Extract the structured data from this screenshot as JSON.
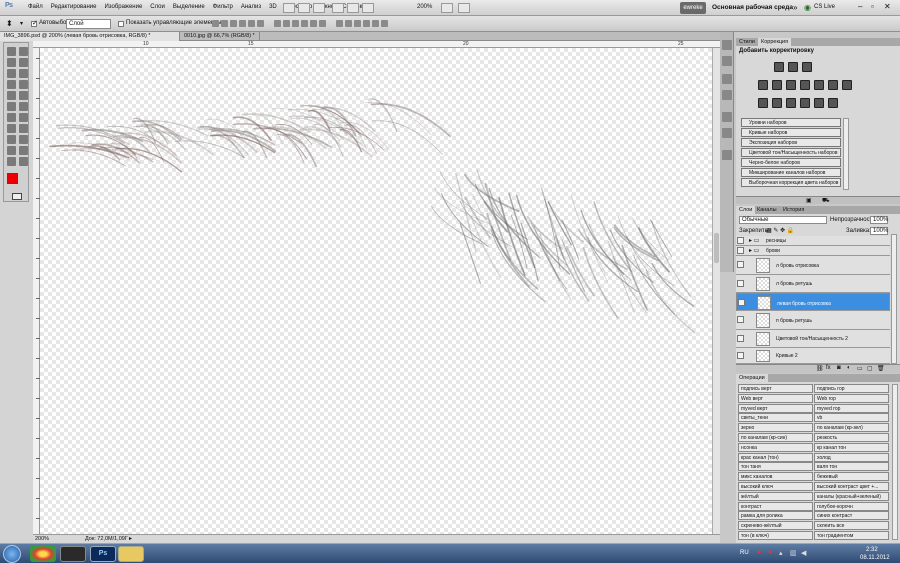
{
  "app": {
    "logo": "Ps",
    "workspace_button": "ewreke",
    "workspace_label": "Основная рабочая среда",
    "cslive": "CS Live"
  },
  "menu": [
    "Файл",
    "Редактирование",
    "Изображение",
    "Слои",
    "Выделение",
    "Фильтр",
    "Анализ",
    "3D",
    "Просмотр",
    "Окно",
    "Справка"
  ],
  "zoom_menu": "200%",
  "options": {
    "autoselect_label": "Автовыбор:",
    "autoselect_value": "Слой",
    "transform_label": "Показать управляющие элементы"
  },
  "doc_tabs": [
    "IMG_3896.psd @ 200% (левая бровь отрисовка, RGB/8) *",
    "0010.jpg @ 66,7% (RGB/8) *"
  ],
  "ruler_marks": [
    "10",
    "15",
    "20",
    "25"
  ],
  "status": {
    "zoom": "200%",
    "doc": "Док: 72,0M/1,09Г"
  },
  "adjustments": {
    "tabs": [
      "Стили",
      "Коррекция"
    ],
    "title": "Добавить корректировку",
    "presets": [
      "Уровни наборов",
      "Кривые наборов",
      "Экспозиция наборов",
      "Цветовой тон/Насыщенность наборов",
      "Черно-белое наборов",
      "Микширование каналов наборов",
      "Выборочная коррекция цвета наборов"
    ]
  },
  "layers": {
    "tabs": [
      "Слои",
      "Каналы",
      "История"
    ],
    "blend_mode": "Обычные",
    "opacity_label": "Непрозрачность:",
    "opacity": "100%",
    "lock_label": "Закрепить:",
    "fill_label": "Заливка:",
    "fill": "100%",
    "items": [
      {
        "name": "ресницы",
        "type": "group"
      },
      {
        "name": "брови",
        "type": "group"
      },
      {
        "name": "л бровь отрисовка",
        "type": "layer"
      },
      {
        "name": "л бровь ретушь",
        "type": "layer"
      },
      {
        "name": "левая бровь отрисовка",
        "type": "layer",
        "selected": true
      },
      {
        "name": "п бровь ретушь",
        "type": "layer"
      },
      {
        "name": "Цветовой тон/Насыщенность 2",
        "type": "adjustment"
      },
      {
        "name": "Кривые 2",
        "type": "adjustment"
      }
    ]
  },
  "actions": {
    "tab": "Операции",
    "rows": [
      [
        "подпись верт",
        "подпись гор"
      ],
      [
        "Web верт",
        "Web гор"
      ],
      [
        "myved верт",
        "myved гор"
      ],
      [
        "светы_тени",
        "vb"
      ],
      [
        "зерно",
        "по каналам (кр-зел)"
      ],
      [
        "по каналам (кр-син)",
        "резкость"
      ],
      [
        "нсонка",
        "кр канал тон"
      ],
      [
        "крас канал (тон)",
        "холод"
      ],
      [
        "тон таня",
        "валя тон"
      ],
      [
        "микс каналов",
        "бежевый"
      ],
      [
        "высокий ключ",
        "высокий контраст цвет +..."
      ],
      [
        "жёлтый",
        "каналы (красный+зеленый)"
      ],
      [
        "контраст",
        "голубое-корочн"
      ],
      [
        "рамка для ролика",
        "синих контраст"
      ],
      [
        "скренево-жёлтый",
        "склеить все"
      ],
      [
        "тон (в ключ)",
        "тон градиентом"
      ]
    ]
  },
  "taskbar": {
    "lang": "RU",
    "time": "2:32",
    "date": "08.11.2012"
  }
}
